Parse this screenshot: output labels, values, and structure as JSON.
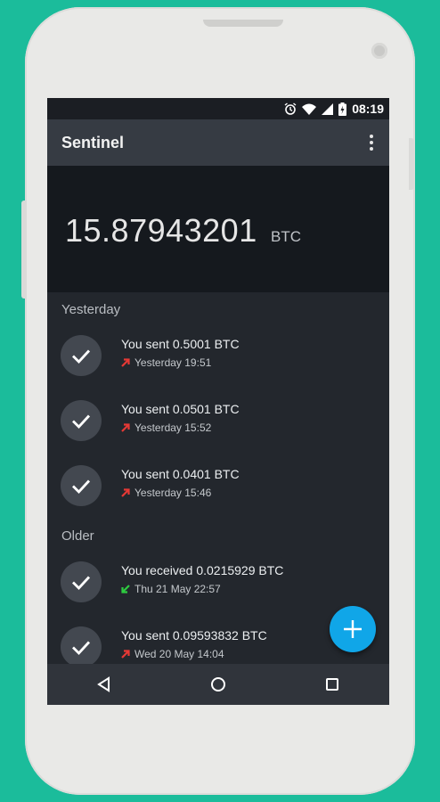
{
  "statusbar": {
    "time": "08:19",
    "icons": [
      "alarm-icon",
      "wifi-icon",
      "signal-icon",
      "battery-charging-icon"
    ]
  },
  "appbar": {
    "title": "Sentinel",
    "menu_icon": "overflow-menu-icon"
  },
  "balance": {
    "amount": "15.87943201",
    "unit": "BTC"
  },
  "sections": [
    {
      "header": "Yesterday",
      "transactions": [
        {
          "title": "You sent 0.5001 BTC",
          "time": "Yesterday 19:51",
          "direction": "sent",
          "icon": "check-icon"
        },
        {
          "title": "You sent 0.0501 BTC",
          "time": "Yesterday 15:52",
          "direction": "sent",
          "icon": "check-icon"
        },
        {
          "title": "You sent 0.0401 BTC",
          "time": "Yesterday 15:46",
          "direction": "sent",
          "icon": "check-icon"
        }
      ]
    },
    {
      "header": "Older",
      "transactions": [
        {
          "title": "You received 0.0215929 BTC",
          "time": "Thu 21 May 22:57",
          "direction": "received",
          "icon": "check-icon"
        },
        {
          "title": "You sent 0.09593832 BTC",
          "time": "Wed 20 May 14:04",
          "direction": "sent",
          "icon": "check-icon"
        }
      ]
    }
  ],
  "fab": {
    "icon": "plus-icon"
  },
  "navbar": {
    "icons": [
      "back-icon",
      "home-icon",
      "recents-icon"
    ]
  },
  "colors": {
    "background": "#1bbc9b",
    "fab": "#10a6e8",
    "sent_arrow": "#e53935",
    "received_arrow": "#2ecc40"
  }
}
